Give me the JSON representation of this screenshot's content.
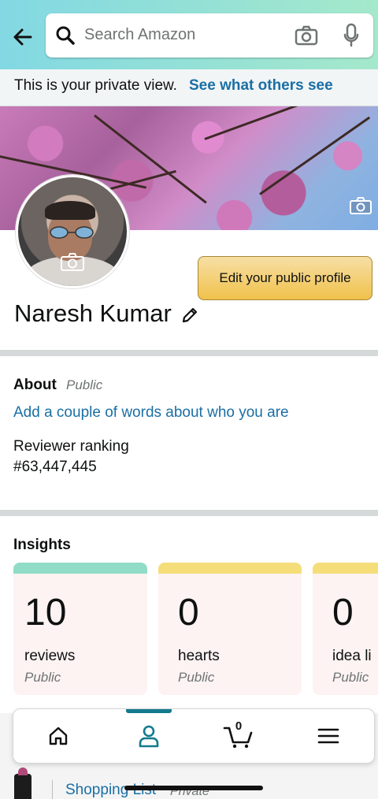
{
  "header": {
    "search_placeholder": "Search Amazon",
    "icons": [
      "back-arrow-icon",
      "search-icon",
      "camera-icon",
      "microphone-icon"
    ]
  },
  "private_notice": {
    "text": "This is your private view.",
    "link": "See what others see"
  },
  "profile": {
    "name": "Naresh Kumar",
    "edit_button": "Edit your public profile"
  },
  "about": {
    "title": "About",
    "visibility": "Public",
    "prompt_link": "Add a couple of words about who you are",
    "ranking_label": "Reviewer ranking",
    "ranking_value": "#63,447,445"
  },
  "insights": {
    "title": "Insights",
    "cards": [
      {
        "count": "10",
        "label": "reviews",
        "visibility": "Public",
        "accent": "#90dcc6"
      },
      {
        "count": "0",
        "label": "hearts",
        "visibility": "Public",
        "accent": "#f5de7a"
      },
      {
        "count": "0",
        "label": "idea li",
        "visibility": "Public",
        "accent": "#f5de7a"
      }
    ]
  },
  "bottom_peek": {
    "link": "Shopping List",
    "visibility": "Private"
  },
  "tabbar": {
    "cart_count": "0",
    "active_tab": "profile",
    "accent": "#137a8e"
  }
}
